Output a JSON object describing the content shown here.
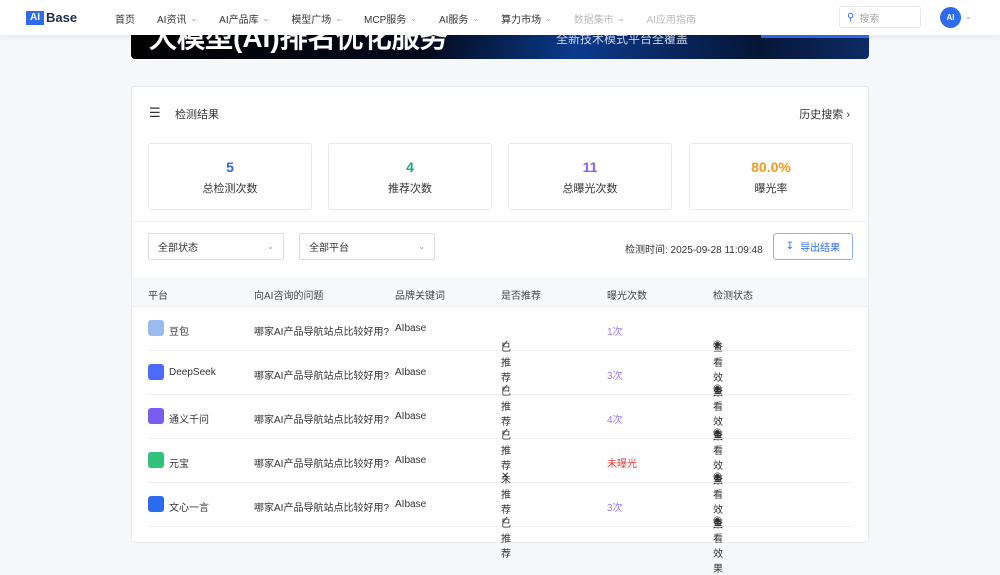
{
  "nav": {
    "logo": "Base",
    "logo_mark": "AI",
    "items": [
      {
        "label": "首页",
        "chev": false,
        "dim": false
      },
      {
        "label": "AI资讯",
        "chev": true,
        "dim": false
      },
      {
        "label": "AI产品库",
        "chev": true,
        "dim": false
      },
      {
        "label": "模型广场",
        "chev": true,
        "dim": false
      },
      {
        "label": "MCP服务",
        "chev": true,
        "dim": false
      },
      {
        "label": "AI服务",
        "chev": true,
        "dim": false
      },
      {
        "label": "算力市场",
        "chev": true,
        "dim": false
      },
      {
        "label": "数据集市",
        "chev": true,
        "dim": true
      },
      {
        "label": "AI应用指南",
        "chev": false,
        "dim": true
      }
    ],
    "search_placeholder": "搜索",
    "avatar": "AI"
  },
  "banner": {
    "title": "大模型(AI)排名优化服务",
    "subtitle": "全新技术模式平台全覆盖"
  },
  "card": {
    "title": "检测结果",
    "history": "历史搜索",
    "stats": [
      {
        "value": "5",
        "label": "总检测次数",
        "color": "#3568d4"
      },
      {
        "value": "4",
        "label": "推荐次数",
        "color": "#1fa58b"
      },
      {
        "value": "11",
        "label": "总曝光次数",
        "color": "#8a5cf0"
      },
      {
        "value": "80.0%",
        "label": "曝光率",
        "color": "#f29a1c"
      }
    ],
    "filters": {
      "status": "全部状态",
      "platform": "全部平台"
    },
    "time": "检测时间: 2025-09-28 11:09:48",
    "export": "导出结果",
    "columns": [
      "平台",
      "向AI咨询的问题",
      "品牌关键词",
      "是否推荐",
      "曝光次数",
      "检测状态"
    ],
    "rows": [
      {
        "platform": "豆包",
        "question": "哪家AI产品导航站点比较好用?",
        "keyword": "AIbase",
        "recommend": "已推荐",
        "ok": true,
        "count": "1次",
        "action": "查看效果",
        "color": "#9bbcf0"
      },
      {
        "platform": "DeepSeek",
        "question": "哪家AI产品导航站点比较好用?",
        "keyword": "AIbase",
        "recommend": "已推荐",
        "ok": true,
        "count": "3次",
        "action": "查看效果",
        "color": "#4d6bfe"
      },
      {
        "platform": "通义千问",
        "question": "哪家AI产品导航站点比较好用?",
        "keyword": "AIbase",
        "recommend": "已推荐",
        "ok": true,
        "count": "4次",
        "action": "查看效果",
        "color": "#7c5cf0"
      },
      {
        "platform": "元宝",
        "question": "哪家AI产品导航站点比较好用?",
        "keyword": "AIbase",
        "recommend": "未推荐",
        "ok": false,
        "count": "未曝光",
        "action": "查看效果",
        "color": "#2fc27a"
      },
      {
        "platform": "文心一言",
        "question": "哪家AI产品导航站点比较好用?",
        "keyword": "AIbase",
        "recommend": "已推荐",
        "ok": true,
        "count": "3次",
        "action": "查看效果",
        "color": "#2b6bf0"
      }
    ]
  }
}
